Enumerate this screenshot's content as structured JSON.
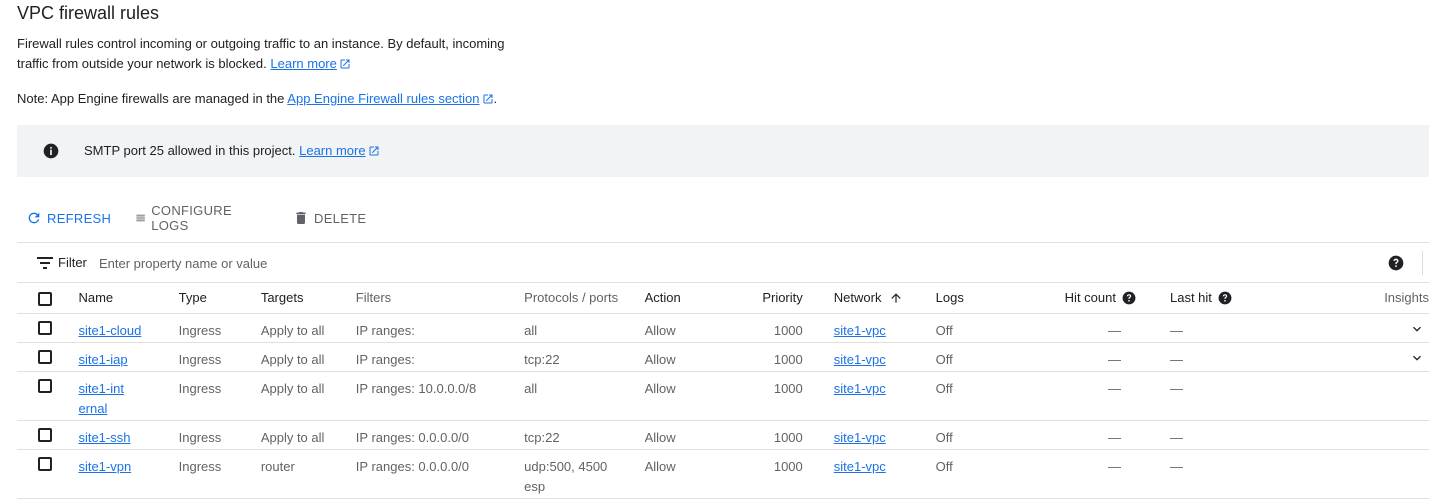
{
  "page": {
    "title": "VPC firewall rules",
    "description": "Firewall rules control incoming or outgoing traffic to an instance. By default, incoming traffic from outside your network is blocked.",
    "description_link": "Learn more",
    "note_prefix": "Note: App Engine firewalls are managed in the",
    "note_link": "App Engine Firewall rules section",
    "note_suffix": "."
  },
  "banner": {
    "icon": "info-icon",
    "message": "SMTP port 25 allowed in this project.",
    "link": "Learn more"
  },
  "toolbar": {
    "refresh_label": "REFRESH",
    "configure_logs_label": "CONFIGURE LOGS",
    "delete_label": "DELETE"
  },
  "filter": {
    "label": "Filter",
    "placeholder": "Enter property name or value"
  },
  "table": {
    "headers": {
      "name": "Name",
      "type": "Type",
      "targets": "Targets",
      "filters": "Filters",
      "protocols": "Protocols / ports",
      "action": "Action",
      "priority": "Priority",
      "network": "Network",
      "logs": "Logs",
      "hit_count": "Hit count",
      "last_hit": "Last hit",
      "insights": "Insights"
    },
    "rows": [
      {
        "name": "site1-cloud",
        "type": "Ingress",
        "targets": "Apply to all",
        "filters": "IP ranges:",
        "protocols": "all",
        "protocols2": "",
        "action": "Allow",
        "priority": "1000",
        "network": "site1-vpc",
        "logs": "Off",
        "hit_count": "—",
        "last_hit": "—"
      },
      {
        "name": "site1-iap",
        "type": "Ingress",
        "targets": "Apply to all",
        "filters": "IP ranges:",
        "protocols": "tcp:22",
        "protocols2": "",
        "action": "Allow",
        "priority": "1000",
        "network": "site1-vpc",
        "logs": "Off",
        "hit_count": "—",
        "last_hit": "—"
      },
      {
        "name": "site1-internal",
        "type": "Ingress",
        "targets": "Apply to all",
        "filters": "IP ranges: 10.0.0.0/8",
        "protocols": "all",
        "protocols2": "",
        "action": "Allow",
        "priority": "1000",
        "network": "site1-vpc",
        "logs": "Off",
        "hit_count": "—",
        "last_hit": "—"
      },
      {
        "name": "site1-ssh",
        "type": "Ingress",
        "targets": "Apply to all",
        "filters": "IP ranges: 0.0.0.0/0",
        "protocols": "tcp:22",
        "protocols2": "",
        "action": "Allow",
        "priority": "1000",
        "network": "site1-vpc",
        "logs": "Off",
        "hit_count": "—",
        "last_hit": "—"
      },
      {
        "name": "site1-vpn",
        "type": "Ingress",
        "targets": "router",
        "filters": "IP ranges: 0.0.0.0/0",
        "protocols": "udp:500, 4500",
        "protocols2": "esp",
        "action": "Allow",
        "priority": "1000",
        "network": "site1-vpc",
        "logs": "Off",
        "hit_count": "—",
        "last_hit": "—"
      }
    ]
  },
  "colors": {
    "link": "#1a73e8",
    "banner_bg": "#f1f3f4",
    "muted_text": "#5f6368"
  }
}
